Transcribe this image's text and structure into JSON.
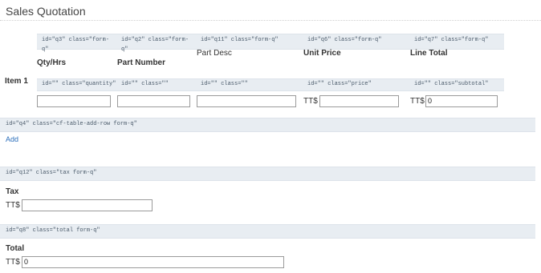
{
  "page": {
    "title": "Sales Quotation"
  },
  "header_meta": {
    "qty": "id=\"q3\" class=\"form-q\"",
    "part_number": "id=\"q2\" class=\"form-q\"",
    "part_desc": "id=\"q11\" class=\"form-q\"",
    "unit_price": "id=\"q6\" class=\"form-q\"",
    "line_total": "id=\"q7\" class=\"form-q\""
  },
  "columns": {
    "qty": "Qty/Hrs",
    "part_number": "Part Number",
    "part_desc": "Part Desc",
    "unit_price": "Unit Price",
    "line_total": "Line Total"
  },
  "item1": {
    "label": "Item 1",
    "meta": {
      "qty": "id=\"\" class=\"quantity\"",
      "part_number": "id=\"\" class=\"\"",
      "part_desc": "id=\"\" class=\"\"",
      "unit_price": "id=\"\" class=\"price\"",
      "line_total": "id=\"\" class=\"subtotal\""
    },
    "values": {
      "qty": "",
      "part_number": "",
      "part_desc": "",
      "unit_price": "",
      "line_total": "0"
    },
    "currency": "TT$"
  },
  "add_row": {
    "meta": "id=\"q4\" class=\"cf-table-add-row form-q\"",
    "label": "Add"
  },
  "tax": {
    "meta": "id=\"q12\" class=\"tax form-q\"",
    "label": "Tax",
    "currency": "TT$",
    "value": ""
  },
  "total": {
    "meta": "id=\"q8\" class=\"total form-q\"",
    "label": "Total",
    "currency": "TT$",
    "value": "0"
  }
}
